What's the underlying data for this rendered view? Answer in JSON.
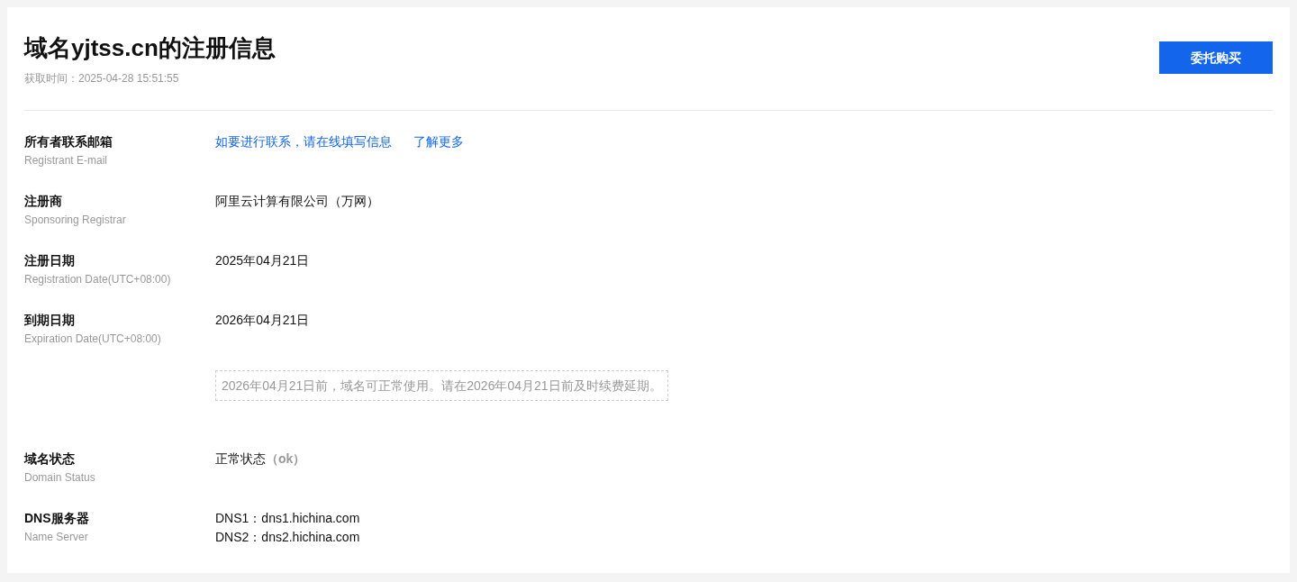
{
  "header": {
    "title": "域名yjtss.cn的注册信息",
    "fetched_at": "获取时间：2025-04-28 15:51:55",
    "button": "委托购买"
  },
  "rows": [
    {
      "kind": "links",
      "label": "所有者联系邮箱",
      "sublabel": "Registrant E-mail",
      "links": [
        "如要进行联系，请在线填写信息",
        "了解更多"
      ]
    },
    {
      "kind": "text",
      "label": "注册商",
      "sublabel": "Sponsoring Registrar",
      "value": "阿里云计算有限公司（万网）"
    },
    {
      "kind": "text",
      "label": "注册日期",
      "sublabel": "Registration Date(UTC+08:00)",
      "value": "2025年04月21日"
    },
    {
      "kind": "text",
      "label": "到期日期",
      "sublabel": "Expiration Date(UTC+08:00)",
      "value": "2026年04月21日",
      "notice": "2026年04月21日前，域名可正常使用。请在2026年04月21日前及时续费延期。"
    },
    {
      "kind": "status",
      "label": "域名状态",
      "sublabel": "Domain Status",
      "value": "正常状态",
      "code": "（ok）"
    },
    {
      "kind": "lines",
      "label": "DNS服务器",
      "sublabel": "Name Server",
      "lines": [
        "DNS1：dns1.hichina.com",
        "DNS2：dns2.hichina.com"
      ]
    }
  ]
}
